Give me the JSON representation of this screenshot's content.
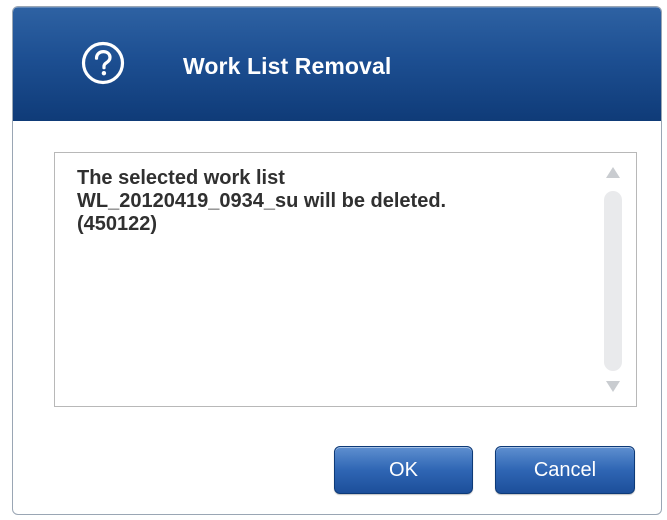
{
  "dialog": {
    "title": "Work List Removal",
    "icon": "question-help-icon",
    "message_lines": [
      "The selected work list",
      "WL_20120419_0934_su will be deleted.",
      "(450122)"
    ],
    "buttons": {
      "ok_label": "OK",
      "cancel_label": "Cancel"
    }
  },
  "colors": {
    "titlebar": "#1d4f92",
    "button": "#2f66b4",
    "message_text": "#303030"
  }
}
